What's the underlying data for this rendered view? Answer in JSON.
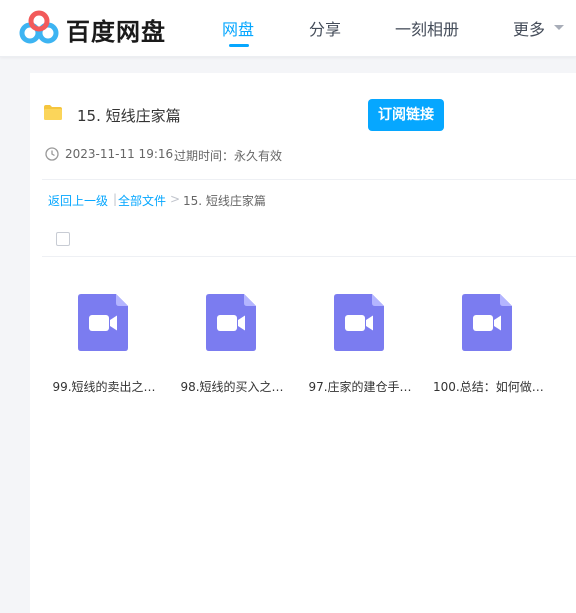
{
  "brand": {
    "name": "百度网盘"
  },
  "nav": {
    "items": [
      {
        "label": "网盘"
      },
      {
        "label": "分享"
      },
      {
        "label": "一刻相册"
      },
      {
        "label": "更多"
      }
    ],
    "active_index": 0
  },
  "share": {
    "folder_title": "15. 短线庄家篇",
    "subscribe_label": "订阅链接",
    "created_time": "2023-11-11 19:16",
    "expiry_label": "过期时间：",
    "expiry_value": "永久有效"
  },
  "breadcrumb": {
    "back": "返回上一级",
    "sep1": "|",
    "all_files": "全部文件",
    "sep2": ">",
    "current": "15. 短线庄家篇"
  },
  "files": [
    {
      "name": "99.短线的卖出之…",
      "icon": "video-file-icon"
    },
    {
      "name": "98.短线的买入之…",
      "icon": "video-file-icon"
    },
    {
      "name": "97.庄家的建仓手…",
      "icon": "video-file-icon"
    },
    {
      "name": "100.总结：如何做…",
      "icon": "video-file-icon"
    }
  ],
  "colors": {
    "accent": "#06a7ff",
    "video_icon": "#7b7cf0",
    "folder": "#f5c53d"
  }
}
